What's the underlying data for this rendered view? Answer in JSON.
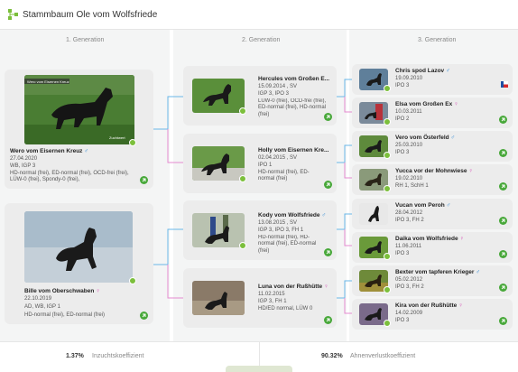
{
  "header": {
    "title": "Stammbaum Ole vom Wolfsfriede"
  },
  "generations": [
    "1. Generation",
    "2. Generation",
    "3. Generation"
  ],
  "gen1": [
    {
      "name": "Wero vom Eisernen Kreuz",
      "sex": "♂",
      "date": "27.04.2020",
      "titles": "WB, IGP 3",
      "health": "HD-normal (frei), ED-normal (frei), OCD-frei (frei), LÜW-0 (frei), Spondy-0 (frei),",
      "photo_caption": "Wero vom Eisernen Kreuz",
      "photo_sub": "Zuchtwert"
    },
    {
      "name": "Bille vom Oberschwaben",
      "sex": "♀",
      "date": "22.10.2019",
      "titles": "AD, WB, IGP 1",
      "health": "HD-normal (frei), ED-normal (frei)"
    }
  ],
  "gen2": [
    {
      "name": "Hercules vom Großen E...",
      "sex": "",
      "date": "15.09.2014 , SV",
      "titles": "IGP 3, IPO 3",
      "health": "LÜW-0 (frei), OCD-frei (frei), ED-normal (frei), HD-normal (frei)"
    },
    {
      "name": "Holly vom Eisernen Kre...",
      "sex": "",
      "date": "02.04.2015 , SV",
      "titles": "IPO 1",
      "health": "HD-normal (frei), ED-normal (frei)"
    },
    {
      "name": "Kody vom Wolfsfriede",
      "sex": "♂",
      "date": "13.08.2015 , SV",
      "titles": "IGP 3, IPO 3, FH 1",
      "health": "HD-normal (frei), HD-normal (frei), ED-normal (frei)"
    },
    {
      "name": "Luna von der Rußhütte",
      "sex": "♀",
      "date": "11.02.2015",
      "titles": "IGP 3, FH 1",
      "health": "HD/ED normal, LÜW 0"
    }
  ],
  "gen3": [
    {
      "name": "Chris spod Lazov",
      "sex": "♂",
      "date": "19.09.2010",
      "titles": "IPO 3"
    },
    {
      "name": "Elsa vom Großen Ex",
      "sex": "♀",
      "date": "10.03.2011",
      "titles": "IPO 2"
    },
    {
      "name": "Vero vom Österfeld",
      "sex": "♂",
      "date": "25.03.2010",
      "titles": "IPO 3"
    },
    {
      "name": "Yucca vor der Mohnwiese",
      "sex": "♀",
      "date": "19.02.2010",
      "titles": "RH 1, SchH 1"
    },
    {
      "name": "Vucan vom Peroh",
      "sex": "♂",
      "date": "28.04.2012",
      "titles": "IPO 3, FH 2"
    },
    {
      "name": "Daika vom Wolfsfriede",
      "sex": "♀",
      "date": "11.06.2011",
      "titles": "IPO 3"
    },
    {
      "name": "Bexter vom tapferen Krieger",
      "sex": "♂",
      "date": "05.02.2012",
      "titles": "IPO 3, FH 2"
    },
    {
      "name": "Kira von der Rußhütte",
      "sex": "♀",
      "date": "14.02.2009",
      "titles": "IPO 3"
    }
  ],
  "footer": {
    "inbreeding_value": "1.37%",
    "inbreeding_label": "Inzuchtskoeffizient",
    "ancestor_value": "90.32%",
    "ancestor_label": "Ahnenverlustkoeffizient"
  },
  "colors": {
    "male_line": "#6ab7e8",
    "female_line": "#e58ad0",
    "accent_green": "#48a83a"
  },
  "icons": {
    "go": "arrow-circle-icon",
    "play": "play-icon",
    "logo": "pedigree-tree-icon",
    "flag": "flag-icon"
  }
}
